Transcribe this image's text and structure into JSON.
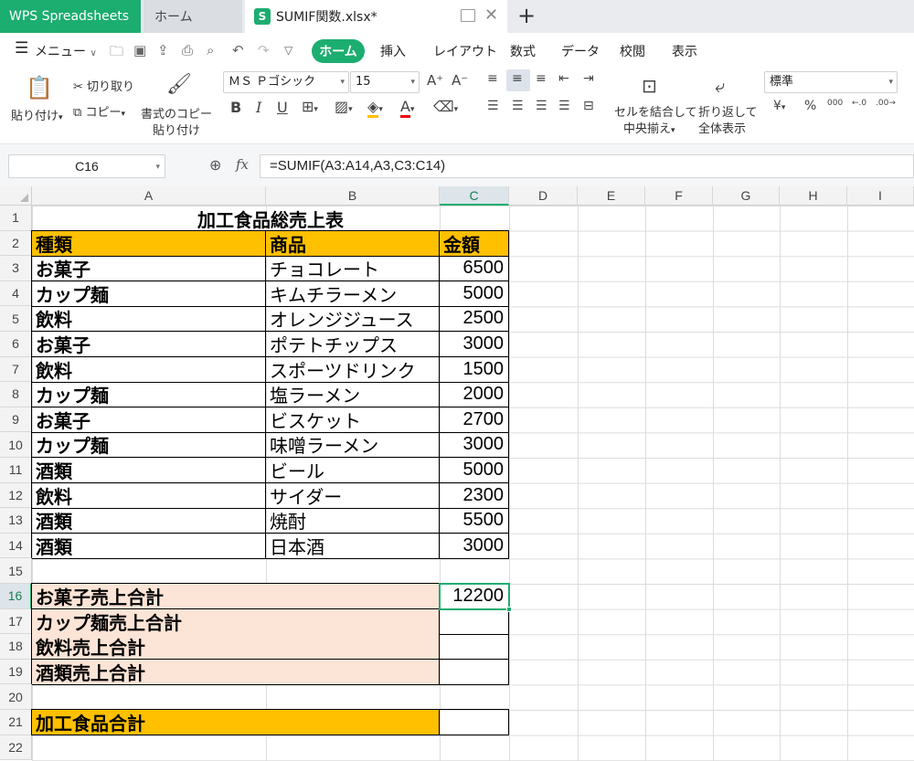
{
  "tabs": {
    "app": "WPS Spreadsheets",
    "home": "ホーム",
    "file": "SUMIF関数.xlsx*",
    "file_icon": "S"
  },
  "menu": {
    "menu_label": "メニュー",
    "tabs": [
      "ホーム",
      "挿入",
      "レイアウト",
      "数式",
      "データ",
      "校閲",
      "表示"
    ]
  },
  "ribbon": {
    "paste": "貼り付け",
    "cut": "切り取り",
    "copy": "コピー",
    "format_painter_1": "書式のコピー",
    "format_painter_2": "貼り付け",
    "font_name": "ＭＳ Ｐゴシック",
    "font_size": "15",
    "merge_1": "セルを結合して",
    "merge_2": "中央揃え",
    "wrap_1": "折り返して",
    "wrap_2": "全体表示",
    "number_format": "標準",
    "yen": "¥",
    "percent": "%",
    "thousands": "000"
  },
  "formula_bar": {
    "cell_ref": "C16",
    "fx": "fx",
    "formula": "=SUMIF(A3:A14,A3,C3:C14)"
  },
  "sheet": {
    "columns": [
      "A",
      "B",
      "C",
      "D",
      "E",
      "F",
      "G",
      "H",
      "I"
    ],
    "rows": [
      "1",
      "2",
      "3",
      "4",
      "5",
      "6",
      "7",
      "8",
      "9",
      "10",
      "11",
      "12",
      "13",
      "14",
      "15",
      "16",
      "17",
      "18",
      "19",
      "20",
      "21",
      "22"
    ],
    "title": "加工食品総売上表",
    "headers": [
      "種類",
      "商品",
      "金額"
    ],
    "data": [
      [
        "お菓子",
        "チョコレート",
        "6500"
      ],
      [
        "カップ麺",
        "キムチラーメン",
        "5000"
      ],
      [
        "飲料",
        "オレンジジュース",
        "2500"
      ],
      [
        "お菓子",
        "ポテトチップス",
        "3000"
      ],
      [
        "飲料",
        "スポーツドリンク",
        "1500"
      ],
      [
        "カップ麺",
        "塩ラーメン",
        "2000"
      ],
      [
        "お菓子",
        "ビスケット",
        "2700"
      ],
      [
        "カップ麺",
        "味噌ラーメン",
        "3000"
      ],
      [
        "酒類",
        "ビール",
        "5000"
      ],
      [
        "飲料",
        "サイダー",
        "2300"
      ],
      [
        "酒類",
        "焼酎",
        "5500"
      ],
      [
        "酒類",
        "日本酒",
        "3000"
      ]
    ],
    "summary": [
      {
        "label": "お菓子売上合計",
        "value": "12200"
      },
      {
        "label": "カップ麺売上合計",
        "value": ""
      },
      {
        "label": "飲料売上合計",
        "value": ""
      },
      {
        "label": "酒類売上合計",
        "value": ""
      }
    ],
    "grand_total": {
      "label": "加工食品合計",
      "value": ""
    }
  }
}
